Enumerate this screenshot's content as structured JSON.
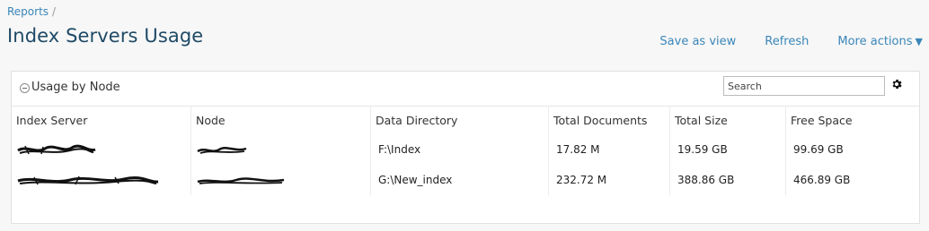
{
  "breadcrumb": {
    "root": "Reports",
    "separator": "/"
  },
  "page": {
    "title": "Index Servers Usage"
  },
  "actions": {
    "save_as_view": "Save as view",
    "refresh": "Refresh",
    "more_actions": "More actions",
    "more_actions_caret": "▼"
  },
  "panel": {
    "title": "Usage by Node",
    "search_placeholder": "Search",
    "columns": [
      "Index Server",
      "Node",
      "Data Directory",
      "Total Documents",
      "Total Size",
      "Free Space"
    ],
    "rows": [
      {
        "data_directory": "F:\\Index",
        "total_documents": "17.82 M",
        "total_size": "19.59 GB",
        "free_space": "99.69 GB"
      },
      {
        "data_directory": "G:\\New_index",
        "total_documents": "232.72 M",
        "total_size": "388.86 GB",
        "free_space": "466.89 GB"
      }
    ]
  },
  "icons": {
    "collapse": "minus-circle-icon",
    "settings": "gear-icon"
  },
  "colors": {
    "link": "#3a86b8",
    "title": "#1f4a66"
  }
}
